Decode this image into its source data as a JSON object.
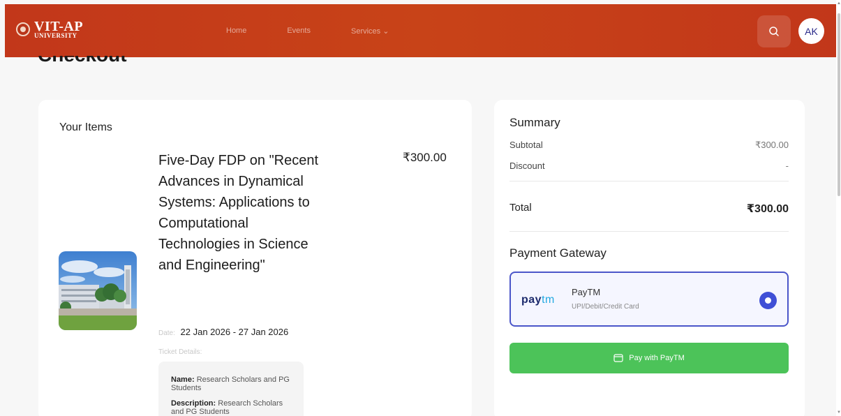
{
  "header": {
    "logo_main": "VIT-AP",
    "logo_sub": "UNIVERSITY",
    "nav": [
      "Home",
      "Events",
      "Services ⌄"
    ],
    "avatar_initials": "AK"
  },
  "page": {
    "title": "Checkout"
  },
  "items": {
    "heading": "Your Items",
    "item": {
      "title": "Five-Day FDP on \"Recent Advances in Dynamical Systems: Applications to Computational Technologies in Science and Engineering\"",
      "price": "₹300.00",
      "date_label": "Date:",
      "date": "22 Jan 2026 - 27 Jan 2026",
      "ticket_label": "Ticket Details:",
      "ticket_name_label": "Name:",
      "ticket_name": "Research Scholars and PG Students",
      "ticket_desc_label": "Description:",
      "ticket_desc": "Research Scholars and PG Students"
    }
  },
  "summary": {
    "title": "Summary",
    "subtotal_label": "Subtotal",
    "subtotal": "₹300.00",
    "discount_label": "Discount",
    "discount": "-",
    "total_label": "Total",
    "total": "₹300.00",
    "gateway_title": "Payment Gateway",
    "gateway": {
      "logo_pay": "pay",
      "logo_tm": "tm",
      "name": "PayTM",
      "subtitle": "UPI/Debit/Credit Card",
      "selected": true
    },
    "pay_button": "Pay with PayTM"
  },
  "colors": {
    "header": "#c2371a",
    "accent": "#3f4fd6",
    "pay_button": "#4cc359"
  },
  "icons": {
    "search": "search-icon",
    "card": "card-icon",
    "logo": "university-seal-icon"
  }
}
